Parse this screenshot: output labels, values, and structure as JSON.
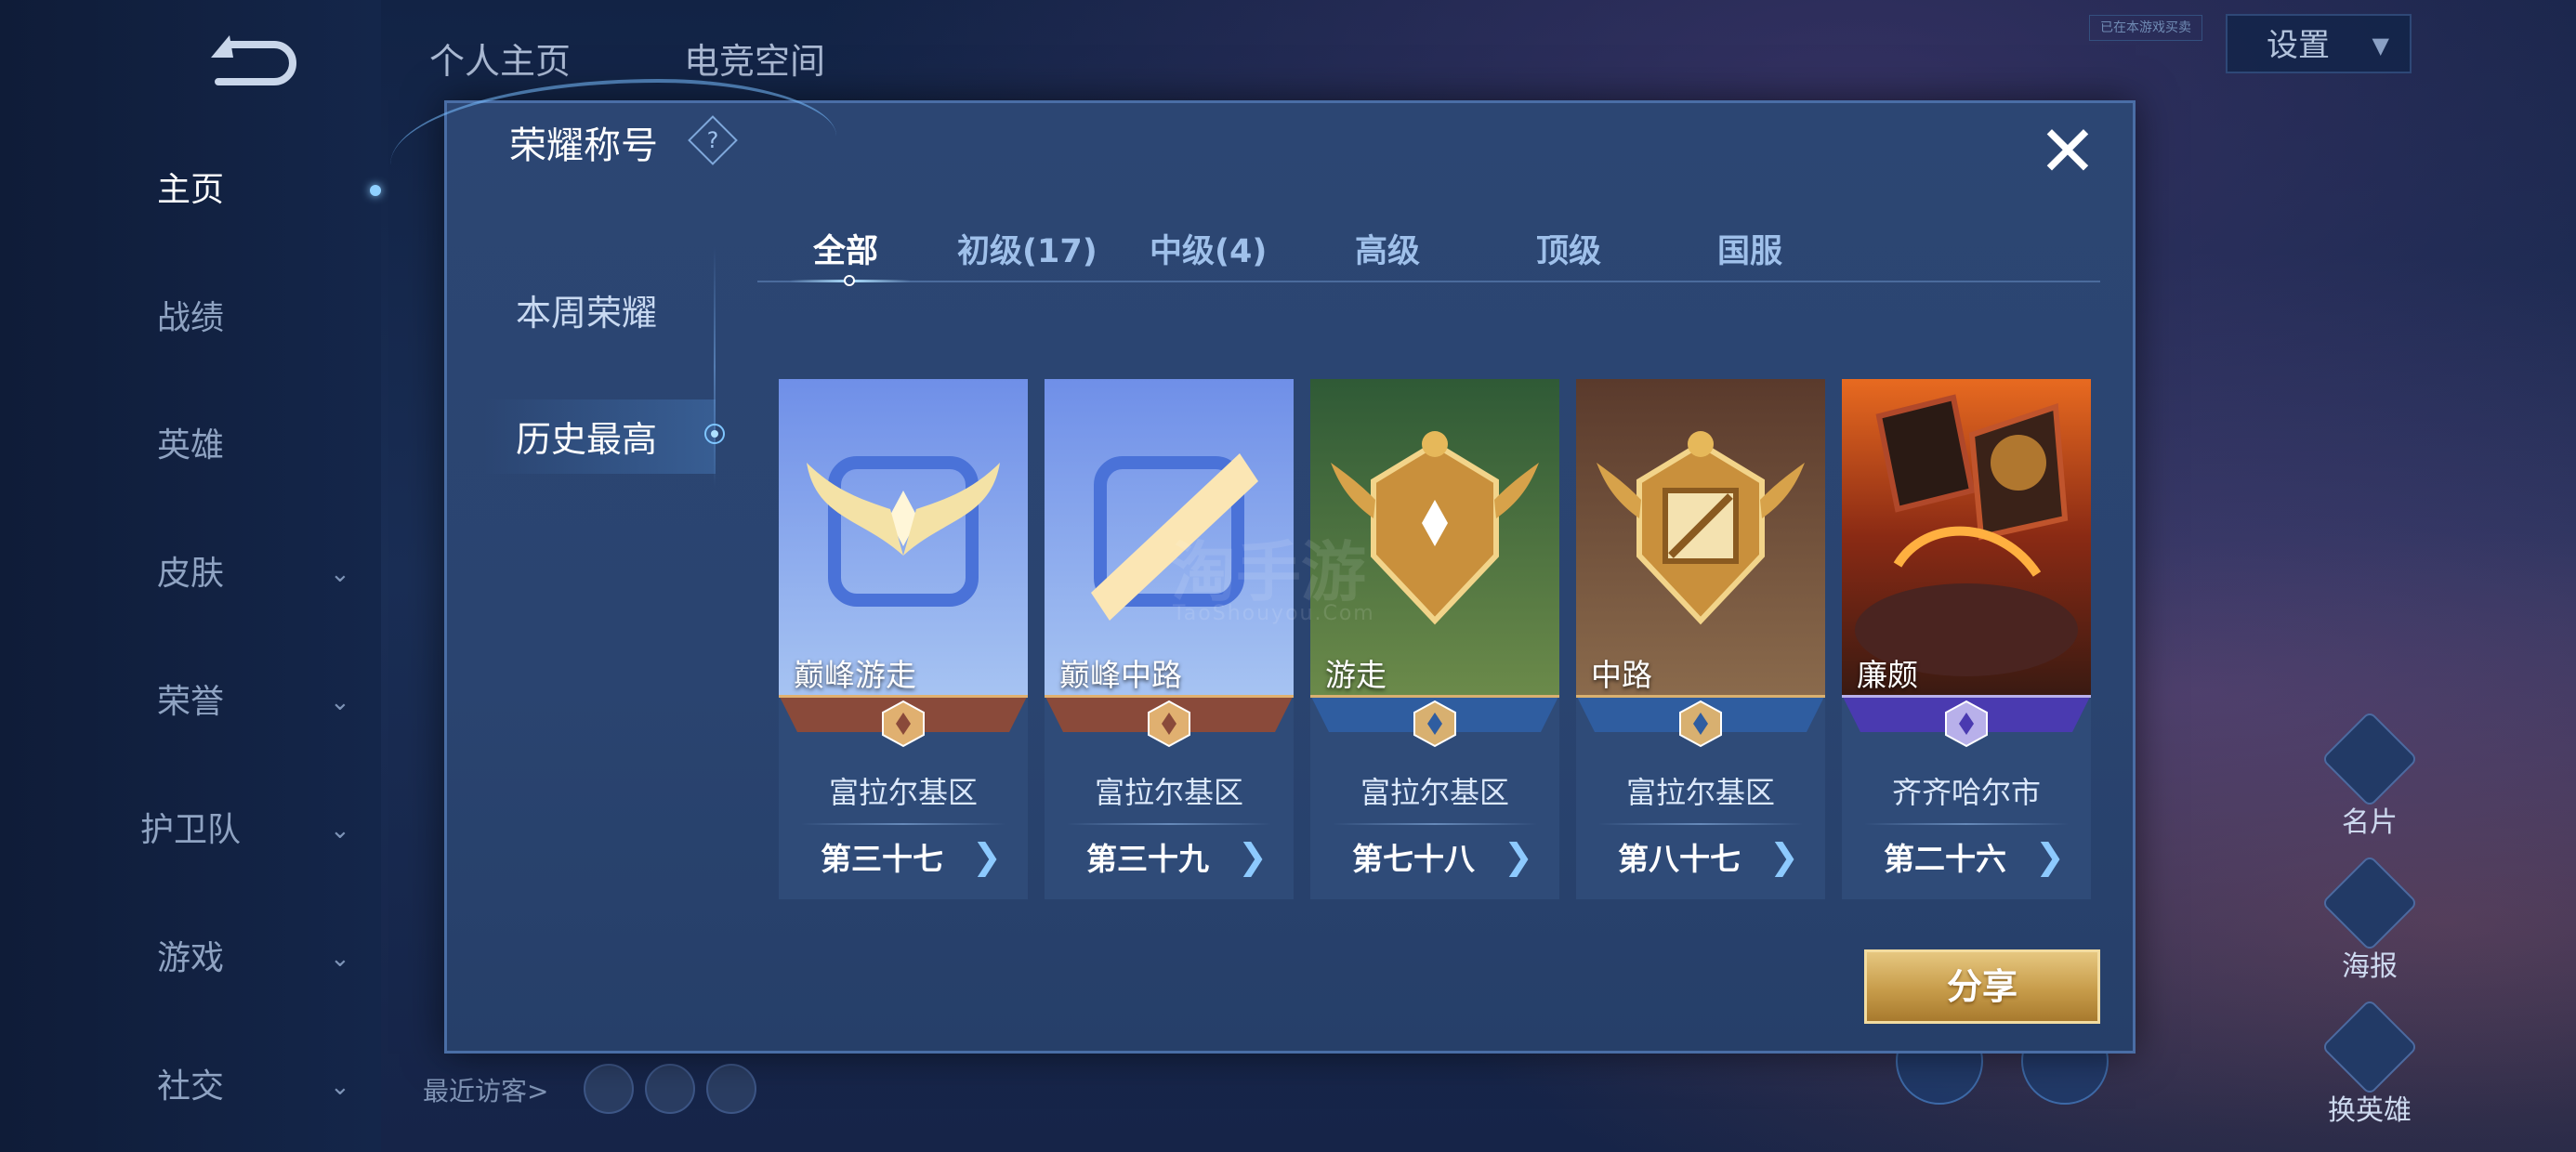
{
  "nav": {
    "items": [
      {
        "label": "主页",
        "chevron": false,
        "active": true
      },
      {
        "label": "战绩",
        "chevron": false,
        "active": false
      },
      {
        "label": "英雄",
        "chevron": false,
        "active": false
      },
      {
        "label": "皮肤",
        "chevron": true,
        "active": false
      },
      {
        "label": "荣誉",
        "chevron": true,
        "active": false
      },
      {
        "label": "护卫队",
        "chevron": true,
        "active": false
      },
      {
        "label": "游戏",
        "chevron": true,
        "active": false
      },
      {
        "label": "社交",
        "chevron": true,
        "active": false
      }
    ],
    "chevron_glyph": "⌄"
  },
  "top_tabs": [
    "个人主页",
    "电竞空间"
  ],
  "settings": {
    "label": "设置",
    "tag": "已在本游戏买卖"
  },
  "recent_visitors": {
    "label": "最近访客>"
  },
  "right_side": [
    {
      "label": "名片",
      "icon": "card-icon"
    },
    {
      "label": "海报",
      "icon": "poster-icon"
    },
    {
      "label": "换英雄",
      "icon": "swap-hero-icon"
    }
  ],
  "modal": {
    "title": "荣耀称号",
    "help_glyph": "?",
    "close_glyph": "✕",
    "side_menu": [
      {
        "label": "本周荣耀",
        "active": false
      },
      {
        "label": "历史最高",
        "active": true
      }
    ],
    "tabs": [
      {
        "label": "全部",
        "active": true
      },
      {
        "label": "初级(17)",
        "active": false
      },
      {
        "label": "中级(4)",
        "active": false
      },
      {
        "label": "高级",
        "active": false
      },
      {
        "label": "顶级",
        "active": false
      },
      {
        "label": "国服",
        "active": false
      }
    ],
    "cards": [
      {
        "name": "巅峰游走",
        "region": "富拉尔基区",
        "rank": "第三十七",
        "art": "peak-support",
        "theme": "blue"
      },
      {
        "name": "巅峰中路",
        "region": "富拉尔基区",
        "rank": "第三十九",
        "art": "peak-mid",
        "theme": "blue"
      },
      {
        "name": "游走",
        "region": "富拉尔基区",
        "rank": "第七十八",
        "art": "support",
        "theme": "green"
      },
      {
        "name": "中路",
        "region": "富拉尔基区",
        "rank": "第八十七",
        "art": "mid",
        "theme": "brown"
      },
      {
        "name": "廉颇",
        "region": "齐齐哈尔市",
        "rank": "第二十六",
        "art": "hero-lianpo",
        "theme": "fire"
      }
    ],
    "arrow_glyph": "❯",
    "share_label": "分享"
  },
  "watermark": {
    "main": "淘手游",
    "sub": "TaoShouyou.Com"
  },
  "colors": {
    "accent": "#8dcaff",
    "gold": "#c79c4a",
    "panel": "#2c4673"
  }
}
